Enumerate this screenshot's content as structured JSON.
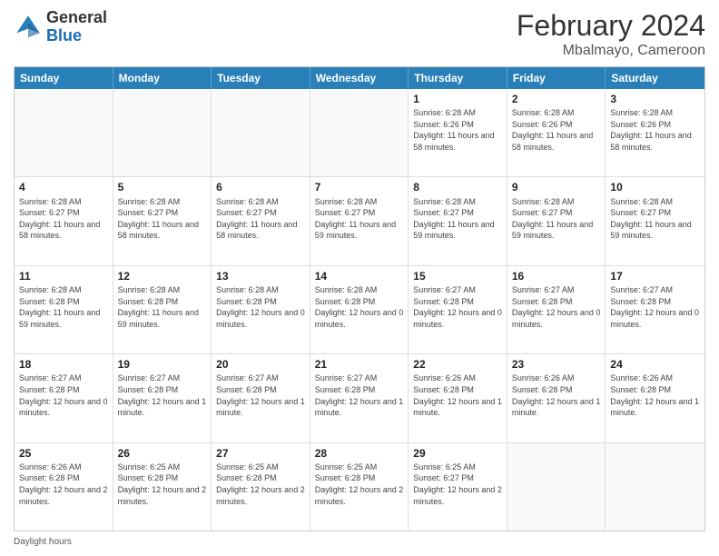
{
  "header": {
    "logo_general": "General",
    "logo_blue": "Blue",
    "title": "February 2024",
    "location": "Mbalmayo, Cameroon"
  },
  "calendar": {
    "days_of_week": [
      "Sunday",
      "Monday",
      "Tuesday",
      "Wednesday",
      "Thursday",
      "Friday",
      "Saturday"
    ],
    "weeks": [
      [
        {
          "day": "",
          "empty": true
        },
        {
          "day": "",
          "empty": true
        },
        {
          "day": "",
          "empty": true
        },
        {
          "day": "",
          "empty": true
        },
        {
          "day": "1",
          "sunrise": "6:28 AM",
          "sunset": "6:26 PM",
          "daylight": "11 hours and 58 minutes."
        },
        {
          "day": "2",
          "sunrise": "6:28 AM",
          "sunset": "6:26 PM",
          "daylight": "11 hours and 58 minutes."
        },
        {
          "day": "3",
          "sunrise": "6:28 AM",
          "sunset": "6:26 PM",
          "daylight": "11 hours and 58 minutes."
        }
      ],
      [
        {
          "day": "4",
          "sunrise": "6:28 AM",
          "sunset": "6:27 PM",
          "daylight": "11 hours and 58 minutes."
        },
        {
          "day": "5",
          "sunrise": "6:28 AM",
          "sunset": "6:27 PM",
          "daylight": "11 hours and 58 minutes."
        },
        {
          "day": "6",
          "sunrise": "6:28 AM",
          "sunset": "6:27 PM",
          "daylight": "11 hours and 58 minutes."
        },
        {
          "day": "7",
          "sunrise": "6:28 AM",
          "sunset": "6:27 PM",
          "daylight": "11 hours and 59 minutes."
        },
        {
          "day": "8",
          "sunrise": "6:28 AM",
          "sunset": "6:27 PM",
          "daylight": "11 hours and 59 minutes."
        },
        {
          "day": "9",
          "sunrise": "6:28 AM",
          "sunset": "6:27 PM",
          "daylight": "11 hours and 59 minutes."
        },
        {
          "day": "10",
          "sunrise": "6:28 AM",
          "sunset": "6:27 PM",
          "daylight": "11 hours and 59 minutes."
        }
      ],
      [
        {
          "day": "11",
          "sunrise": "6:28 AM",
          "sunset": "6:28 PM",
          "daylight": "11 hours and 59 minutes."
        },
        {
          "day": "12",
          "sunrise": "6:28 AM",
          "sunset": "6:28 PM",
          "daylight": "11 hours and 59 minutes."
        },
        {
          "day": "13",
          "sunrise": "6:28 AM",
          "sunset": "6:28 PM",
          "daylight": "12 hours and 0 minutes."
        },
        {
          "day": "14",
          "sunrise": "6:28 AM",
          "sunset": "6:28 PM",
          "daylight": "12 hours and 0 minutes."
        },
        {
          "day": "15",
          "sunrise": "6:27 AM",
          "sunset": "6:28 PM",
          "daylight": "12 hours and 0 minutes."
        },
        {
          "day": "16",
          "sunrise": "6:27 AM",
          "sunset": "6:28 PM",
          "daylight": "12 hours and 0 minutes."
        },
        {
          "day": "17",
          "sunrise": "6:27 AM",
          "sunset": "6:28 PM",
          "daylight": "12 hours and 0 minutes."
        }
      ],
      [
        {
          "day": "18",
          "sunrise": "6:27 AM",
          "sunset": "6:28 PM",
          "daylight": "12 hours and 0 minutes."
        },
        {
          "day": "19",
          "sunrise": "6:27 AM",
          "sunset": "6:28 PM",
          "daylight": "12 hours and 1 minute."
        },
        {
          "day": "20",
          "sunrise": "6:27 AM",
          "sunset": "6:28 PM",
          "daylight": "12 hours and 1 minute."
        },
        {
          "day": "21",
          "sunrise": "6:27 AM",
          "sunset": "6:28 PM",
          "daylight": "12 hours and 1 minute."
        },
        {
          "day": "22",
          "sunrise": "6:26 AM",
          "sunset": "6:28 PM",
          "daylight": "12 hours and 1 minute."
        },
        {
          "day": "23",
          "sunrise": "6:26 AM",
          "sunset": "6:28 PM",
          "daylight": "12 hours and 1 minute."
        },
        {
          "day": "24",
          "sunrise": "6:26 AM",
          "sunset": "6:28 PM",
          "daylight": "12 hours and 1 minute."
        }
      ],
      [
        {
          "day": "25",
          "sunrise": "6:26 AM",
          "sunset": "6:28 PM",
          "daylight": "12 hours and 2 minutes."
        },
        {
          "day": "26",
          "sunrise": "6:25 AM",
          "sunset": "6:28 PM",
          "daylight": "12 hours and 2 minutes."
        },
        {
          "day": "27",
          "sunrise": "6:25 AM",
          "sunset": "6:28 PM",
          "daylight": "12 hours and 2 minutes."
        },
        {
          "day": "28",
          "sunrise": "6:25 AM",
          "sunset": "6:28 PM",
          "daylight": "12 hours and 2 minutes."
        },
        {
          "day": "29",
          "sunrise": "6:25 AM",
          "sunset": "6:27 PM",
          "daylight": "12 hours and 2 minutes."
        },
        {
          "day": "",
          "empty": true
        },
        {
          "day": "",
          "empty": true
        }
      ]
    ]
  },
  "footer": {
    "label": "Daylight hours"
  }
}
